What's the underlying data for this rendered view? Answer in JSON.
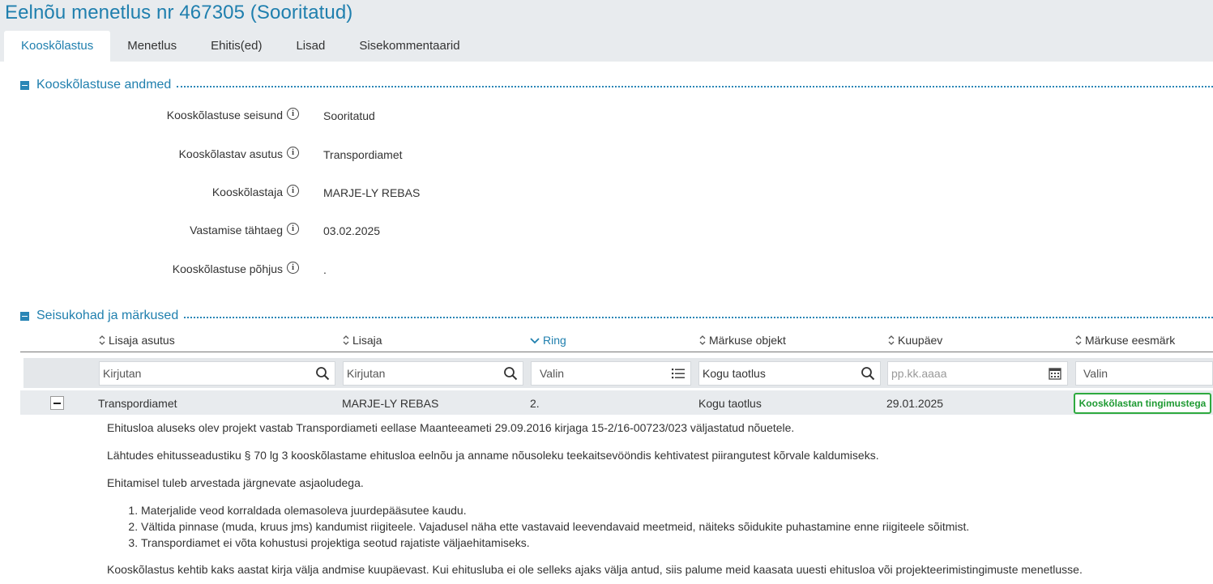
{
  "page": {
    "title": "Eelnõu menetlus nr 467305 (Sooritatud)"
  },
  "tabs": [
    {
      "label": "Kooskõlastus",
      "active": true
    },
    {
      "label": "Menetlus"
    },
    {
      "label": "Ehitis(ed)"
    },
    {
      "label": "Lisad"
    },
    {
      "label": "Sisekommentaarid"
    }
  ],
  "approval_section": {
    "title": "Kooskõlastuse andmed",
    "fields": [
      {
        "label": "Kooskõlastuse seisund",
        "value": "Sooritatud"
      },
      {
        "label": "Kooskõlastav asutus",
        "value": "Transpordiamet"
      },
      {
        "label": "Kooskõlastaja",
        "value": "MARJE-LY REBAS"
      },
      {
        "label": "Vastamise tähtaeg",
        "value": "03.02.2025"
      },
      {
        "label": "Kooskõlastuse põhjus",
        "value": "."
      }
    ]
  },
  "remarks_section": {
    "title": "Seisukohad ja märkused",
    "columns": [
      {
        "label": "Lisaja asutus"
      },
      {
        "label": "Lisaja"
      },
      {
        "label": "Ring",
        "sorted": true
      },
      {
        "label": "Märkuse objekt"
      },
      {
        "label": "Kuupäev"
      },
      {
        "label": "Märkuse eesmärk"
      }
    ],
    "filters": [
      {
        "placeholder": "Kirjutan",
        "icon": "search-icon"
      },
      {
        "placeholder": "Kirjutan",
        "icon": "search-icon"
      },
      {
        "placeholder": "Valin",
        "icon": "list-icon"
      },
      {
        "value": "Kogu taotlus",
        "icon": "search-icon"
      },
      {
        "placeholder": "pp.kk.aaaa",
        "icon": "calendar-icon"
      },
      {
        "placeholder": "Valin"
      }
    ],
    "row": {
      "institution": "Transpordiamet",
      "author": "MARJE-LY REBAS",
      "round": "2.",
      "object": "Kogu taotlus",
      "date": "29.01.2025",
      "purpose": "Kooskõlastan tingimustega",
      "purpose_color": "#2eaa3f"
    },
    "comment": {
      "p1": "Ehitusloa aluseks olev projekt vastab Transpordiameti eellase Maanteeameti 29.09.2016 kirjaga 15-2/16-00723/023 väljastatud nõuetele.",
      "p2": "Lähtudes ehitusseadustiku § 70 lg 3 kooskõlastame ehitusloa eelnõu ja anname nõusoleku teekaitsevööndis kehtivatest piirangutest kõrvale kaldumiseks.",
      "p3": "Ehitamisel tuleb arvestada järgnevate asjaoludega.",
      "list": [
        "Materjalide veod korraldada olemasoleva juurdepääsutee kaudu.",
        "Vältida pinnase (muda, kruus jms) kandumist riigiteele. Vajadusel näha ette vastavaid leevendavaid meetmeid, näiteks sõidukite puhastamine enne riigiteele sõitmist.",
        "Transpordiamet ei võta kohustusi projektiga seotud rajatiste väljaehitamiseks."
      ],
      "p4": "Kooskõlastus kehtib kaks aastat kirja välja andmise kuupäevast. Kui ehitusluba ei ole selleks ajaks välja antud, siis palume meid kaasata uuesti ehitusloa või projekteerimistingimuste menetlusse."
    }
  },
  "colors": {
    "accent": "#1f7fae",
    "header_bg": "#e8ebee",
    "success": "#2eaa3f"
  }
}
